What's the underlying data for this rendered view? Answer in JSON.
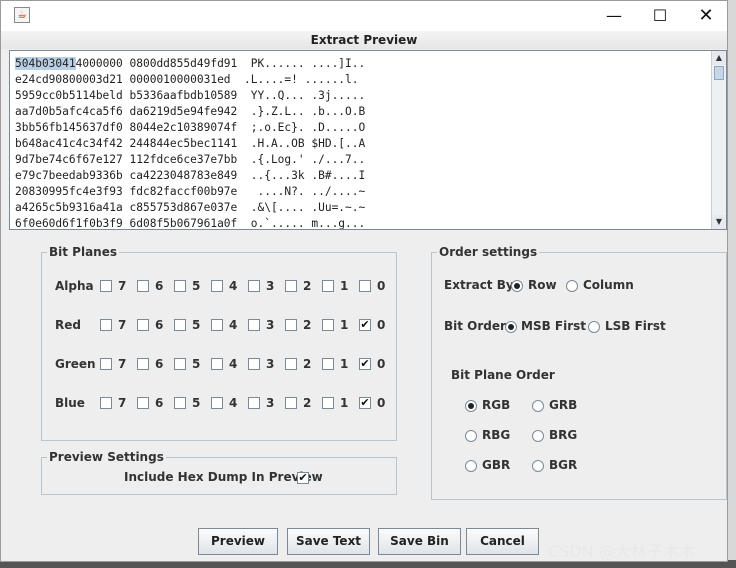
{
  "window": {
    "icon": "java-icon",
    "controls": {
      "minimize": "—",
      "maximize": "☐",
      "close": "✕"
    }
  },
  "dialog_title": "Extract Preview",
  "preview": {
    "selected_text": "504b03041",
    "lines": [
      "504b030414000000 0800dd855d49fd91  PK...... ....]I..",
      "e24cd90800003d21 0000010000031ed  .L....=! ......l.",
      "5959cc0b5114beld b5336aafbdb10589  YY..Q... .3j.....",
      "aa7d0b5afc4ca5f6 da6219d5e94fe942  .}.Z.L.. .b...O.B",
      "3bb56fb145637df0 8044e2c10389074f  ;.o.Ec}. .D.....O",
      "b648ac41c4c34f42 244844ec5bec1141  .H.A..OB $HD.[..A",
      "9d7be74c6f67e127 112fdce6ce37e7bb  .{.Log.' ./...7..",
      "e79c7beedab9336b ca4223048783e849  ..{...3k .B#....I",
      "20830995fc4e3f93 fdc82faccf00b97e   ....N?. ../....~",
      "a4265c5b9316a41a c855753d867e037e  .&\\[.... .Uu=.~.~",
      "6f0e60d6f1f0b3f9 6d08f5b067961a0f  o.`..... m...g..."
    ]
  },
  "bit_planes": {
    "title": "Bit Planes",
    "bits": [
      "7",
      "6",
      "5",
      "4",
      "3",
      "2",
      "1",
      "0"
    ],
    "rows": [
      {
        "label": "Alpha",
        "checked": [
          false,
          false,
          false,
          false,
          false,
          false,
          false,
          false
        ]
      },
      {
        "label": "Red",
        "checked": [
          false,
          false,
          false,
          false,
          false,
          false,
          false,
          true
        ]
      },
      {
        "label": "Green",
        "checked": [
          false,
          false,
          false,
          false,
          false,
          false,
          false,
          true
        ]
      },
      {
        "label": "Blue",
        "checked": [
          false,
          false,
          false,
          false,
          false,
          false,
          false,
          true
        ]
      }
    ]
  },
  "preview_settings": {
    "title": "Preview Settings",
    "include_hex_dump_label": "Include Hex Dump In Preview",
    "include_hex_dump": true
  },
  "order_settings": {
    "title": "Order settings",
    "extract_by_label": "Extract By",
    "extract_by_options": [
      "Row",
      "Column"
    ],
    "extract_by_selected": "Row",
    "bit_order_label": "Bit Order",
    "bit_order_options": [
      "MSB First",
      "LSB First"
    ],
    "bit_order_selected": "MSB First",
    "bit_plane_order_label": "Bit Plane Order",
    "bit_plane_order_options": [
      "RGB",
      "GRB",
      "RBG",
      "BRG",
      "GBR",
      "BGR"
    ],
    "bit_plane_order_selected": "RGB"
  },
  "buttons": {
    "preview": "Preview",
    "save_text": "Save Text",
    "save_bin": "Save Bin",
    "cancel": "Cancel"
  },
  "watermark": "CSDN @大林子木木"
}
